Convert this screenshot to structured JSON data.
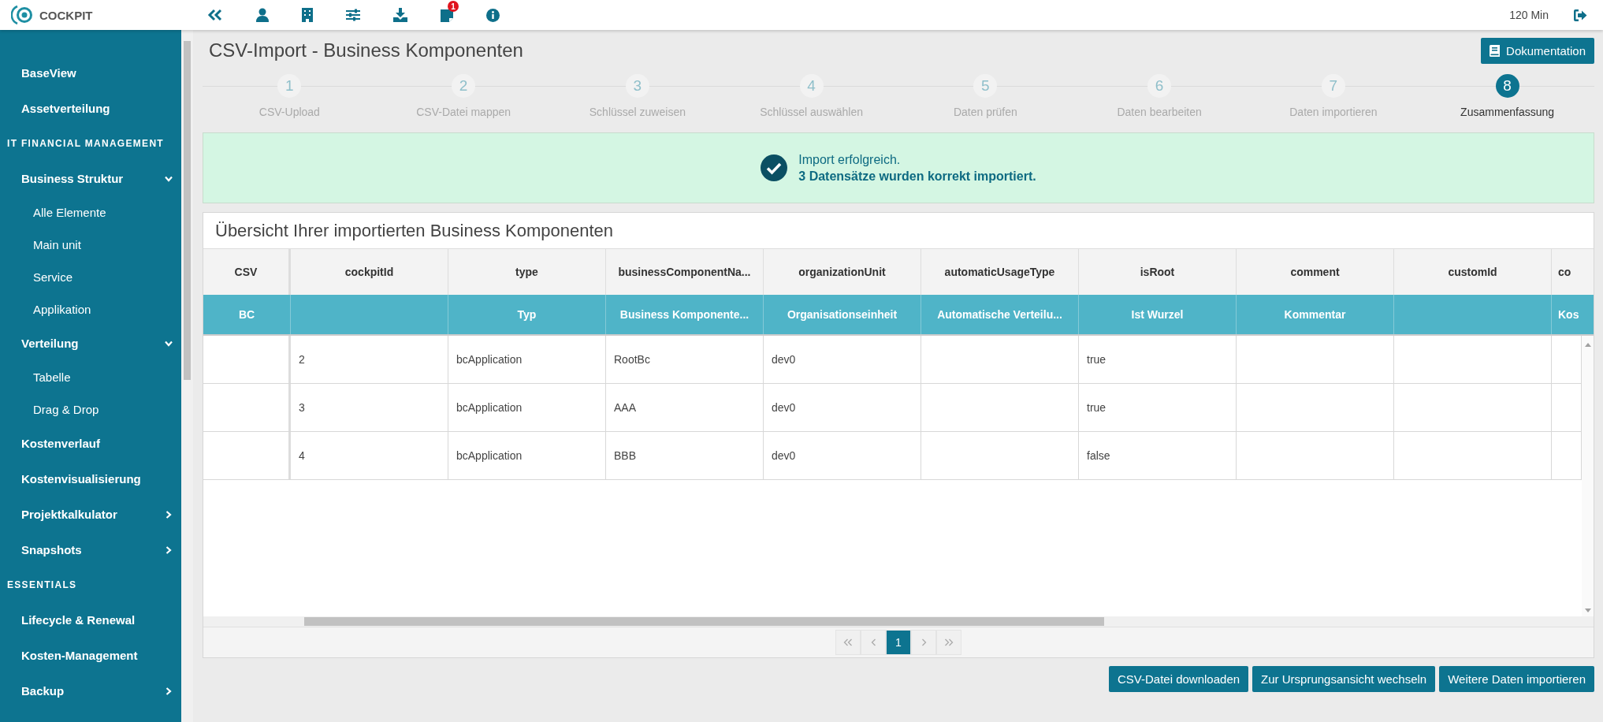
{
  "topbar": {
    "logo_text": "COCKPIT",
    "notification_badge": "1",
    "session_time": "120 Min"
  },
  "sidebar": {
    "sections": [
      {
        "items": [
          {
            "label": "BaseView"
          },
          {
            "label": "Assetverteilung"
          }
        ]
      },
      {
        "heading": "IT FINANCIAL MANAGEMENT",
        "items": [
          {
            "label": "Business Struktur",
            "expanded": true,
            "children": [
              {
                "label": "Alle Elemente"
              },
              {
                "label": "Main unit"
              },
              {
                "label": "Service"
              },
              {
                "label": "Applikation"
              }
            ]
          },
          {
            "label": "Verteilung",
            "expanded": true,
            "children": [
              {
                "label": "Tabelle"
              },
              {
                "label": "Drag & Drop"
              }
            ]
          },
          {
            "label": "Kostenverlauf"
          },
          {
            "label": "Kostenvisualisierung"
          },
          {
            "label": "Projektkalkulator",
            "expanded": false
          },
          {
            "label": "Snapshots",
            "expanded": false
          }
        ]
      },
      {
        "heading": "ESSENTIALS",
        "items": [
          {
            "label": "Lifecycle & Renewal"
          },
          {
            "label": "Kosten-Management"
          },
          {
            "label": "Backup",
            "expanded": false
          }
        ]
      }
    ]
  },
  "page": {
    "title": "CSV-Import - Business Komponenten",
    "doc_button": "Dokumentation"
  },
  "steps": [
    {
      "number": "1",
      "label": "CSV-Upload",
      "selected": false
    },
    {
      "number": "2",
      "label": "CSV-Datei mappen",
      "selected": false
    },
    {
      "number": "3",
      "label": "Schlüssel zuweisen",
      "selected": false
    },
    {
      "number": "4",
      "label": "Schlüssel auswählen",
      "selected": false
    },
    {
      "number": "5",
      "label": "Daten prüfen",
      "selected": false
    },
    {
      "number": "6",
      "label": "Daten bearbeiten",
      "selected": false
    },
    {
      "number": "7",
      "label": "Daten importieren",
      "selected": false
    },
    {
      "number": "8",
      "label": "Zusammenfassung",
      "selected": true
    }
  ],
  "success": {
    "title": "Import erfolgreich.",
    "message": "3 Datensätze wurden korrekt importiert."
  },
  "table": {
    "title": "Übersicht Ihrer importierten Business Komponenten",
    "columns": [
      {
        "name": "CSV",
        "label": "BC"
      },
      {
        "name": "cockpitId"
      },
      {
        "name": "type",
        "label": "Typ"
      },
      {
        "name": "businessComponentNa...",
        "label": "Business Komponente..."
      },
      {
        "name": "organizationUnit",
        "label": "Organisationseinheit"
      },
      {
        "name": "automaticUsageType",
        "label": "Automatische Verteilu..."
      },
      {
        "name": "isRoot",
        "label": "Ist Wurzel"
      },
      {
        "name": "comment",
        "label": "Kommentar"
      },
      {
        "name": "customId"
      },
      {
        "name": "co",
        "label": "Kos"
      }
    ],
    "rows": [
      {
        "cells": [
          null,
          "2",
          "bcApplication",
          "RootBc",
          "dev0",
          null,
          "true",
          null,
          null,
          null
        ]
      },
      {
        "cells": [
          null,
          "3",
          "bcApplication",
          "AAA",
          "dev0",
          null,
          "true",
          null,
          null,
          null
        ]
      },
      {
        "cells": [
          null,
          "4",
          "bcApplication",
          "BBB",
          "dev0",
          null,
          "false",
          null,
          null,
          null
        ]
      }
    ],
    "pages": [
      {
        "label": "1",
        "selected": true
      }
    ]
  },
  "buttons": [
    "CSV-Datei downloaden",
    "Zur Ursprungsansicht wechseln",
    "Weitere Daten importieren"
  ]
}
